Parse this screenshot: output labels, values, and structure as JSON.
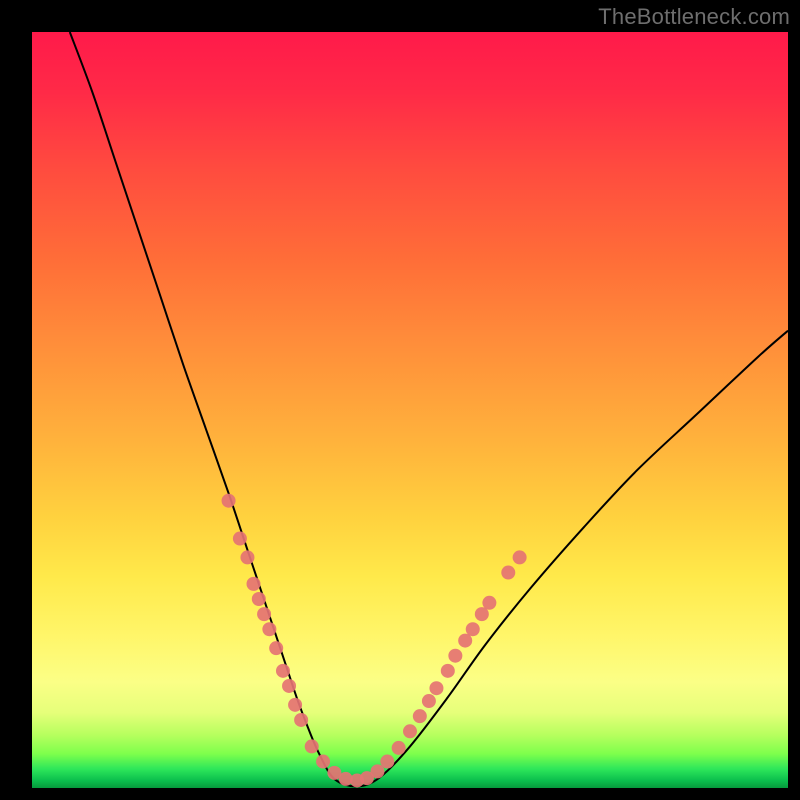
{
  "watermark": "TheBottleneck.com",
  "chart_data": {
    "type": "line",
    "title": "",
    "xlabel": "",
    "ylabel": "",
    "xlim": [
      0,
      100
    ],
    "ylim": [
      0,
      100
    ],
    "grid": false,
    "legend": false,
    "background_gradient": {
      "top": "#ff1a4a",
      "mid_upper": "#ff903a",
      "mid_lower": "#fff66a",
      "bottom": "#069a3d",
      "meaning": "red = high bottleneck, green = optimal match"
    },
    "series": [
      {
        "name": "bottleneck-curve",
        "color": "#000000",
        "x": [
          5,
          8,
          11,
          14,
          17,
          20,
          23,
          26,
          28,
          30,
          32,
          33.5,
          35,
          36.5,
          38,
          40,
          43,
          46,
          50,
          55,
          60,
          66,
          73,
          80,
          88,
          96,
          100
        ],
        "y": [
          100,
          92,
          83,
          74,
          65,
          56,
          47.5,
          39,
          33,
          27,
          21,
          16.5,
          12,
          8,
          4.5,
          1.2,
          0.2,
          1.4,
          5.5,
          12,
          19,
          26.5,
          34.5,
          42,
          49.5,
          57,
          60.5
        ]
      }
    ],
    "annotations": {
      "dot_clusters": [
        {
          "name": "left-arm-dots",
          "color": "#e57373",
          "approx_radius_px": 7,
          "points": [
            {
              "x": 26.0,
              "y": 38.0
            },
            {
              "x": 27.5,
              "y": 33.0
            },
            {
              "x": 28.5,
              "y": 30.5
            },
            {
              "x": 29.3,
              "y": 27.0
            },
            {
              "x": 30.0,
              "y": 25.0
            },
            {
              "x": 30.7,
              "y": 23.0
            },
            {
              "x": 31.4,
              "y": 21.0
            },
            {
              "x": 32.3,
              "y": 18.5
            },
            {
              "x": 33.2,
              "y": 15.5
            },
            {
              "x": 34.0,
              "y": 13.5
            },
            {
              "x": 34.8,
              "y": 11.0
            },
            {
              "x": 35.6,
              "y": 9.0
            }
          ]
        },
        {
          "name": "valley-floor-dots",
          "color": "#e57373",
          "approx_radius_px": 7,
          "points": [
            {
              "x": 37.0,
              "y": 5.5
            },
            {
              "x": 38.5,
              "y": 3.5
            },
            {
              "x": 40.0,
              "y": 2.0
            },
            {
              "x": 41.5,
              "y": 1.2
            },
            {
              "x": 43.0,
              "y": 1.0
            },
            {
              "x": 44.3,
              "y": 1.3
            },
            {
              "x": 45.7,
              "y": 2.2
            },
            {
              "x": 47.0,
              "y": 3.5
            }
          ]
        },
        {
          "name": "right-arm-dots",
          "color": "#e57373",
          "approx_radius_px": 7,
          "points": [
            {
              "x": 48.5,
              "y": 5.3
            },
            {
              "x": 50.0,
              "y": 7.5
            },
            {
              "x": 51.3,
              "y": 9.5
            },
            {
              "x": 52.5,
              "y": 11.5
            },
            {
              "x": 53.5,
              "y": 13.2
            },
            {
              "x": 55.0,
              "y": 15.5
            },
            {
              "x": 56.0,
              "y": 17.5
            },
            {
              "x": 57.3,
              "y": 19.5
            },
            {
              "x": 58.3,
              "y": 21.0
            },
            {
              "x": 59.5,
              "y": 23.0
            },
            {
              "x": 60.5,
              "y": 24.5
            },
            {
              "x": 63.0,
              "y": 28.5
            },
            {
              "x": 64.5,
              "y": 30.5
            }
          ]
        }
      ]
    }
  }
}
